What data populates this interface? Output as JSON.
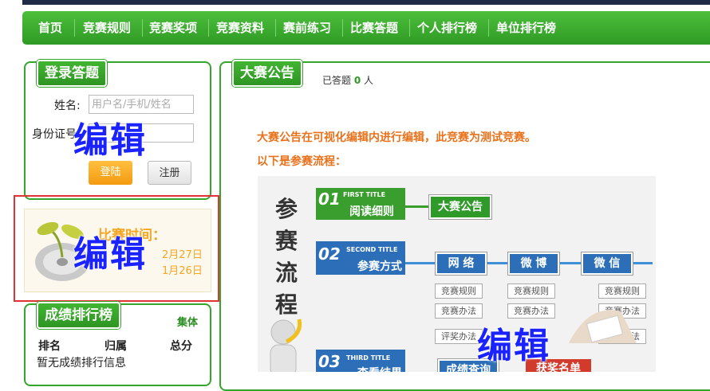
{
  "nav": {
    "items": [
      "首页",
      "竞赛规则",
      "竞赛奖项",
      "竞赛资料",
      "赛前练习",
      "比赛答题",
      "个人排行榜",
      "单位排行榜"
    ]
  },
  "login": {
    "title": "登录答题",
    "name_label": "姓名:",
    "name_placeholder": "用户名/手机/姓名",
    "id_label": "身份证号",
    "login_button": "登陆",
    "register_button": "注册"
  },
  "promo": {
    "title_partial": "比赛时间：",
    "line1_partial": "2月27日",
    "line2_partial": "1月26日"
  },
  "ranking": {
    "title": "成绩排行榜",
    "mode": "集体",
    "headers": [
      "排名",
      "归属",
      "总分"
    ],
    "empty": "暂无成绩排行信息"
  },
  "notice": {
    "title": "大赛公告",
    "answered_prefix": "已答题",
    "answered_count": "0",
    "answered_suffix": "人",
    "text1": "大赛公告在可视化编辑内进行编辑，此竞赛为测试竞赛。",
    "text2": "以下是参赛流程："
  },
  "flow": {
    "vertical_title": [
      "参",
      "赛",
      "流",
      "程"
    ],
    "step1": {
      "num": "01",
      "en": "FIRST TITLE",
      "cn": "阅读细则",
      "next": "大赛公告"
    },
    "step2": {
      "num": "02",
      "en": "SECOND TITLE",
      "cn": "参赛方式",
      "channels": [
        "网 络",
        "微 博",
        "微 信"
      ],
      "sub": [
        "竞赛规则",
        "竞赛办法",
        "评奖办法"
      ]
    },
    "step3": {
      "num": "03",
      "en": "THIRD TITLE",
      "cn": "查看结果",
      "query": "成绩查询",
      "award": "获奖名单"
    }
  },
  "overlay": {
    "edit_text": "编辑"
  },
  "colors": {
    "green": "#36a52c",
    "orange": "#e8721c",
    "blue_overlay": "#1a22ff",
    "highlight_red": "#e03434"
  }
}
